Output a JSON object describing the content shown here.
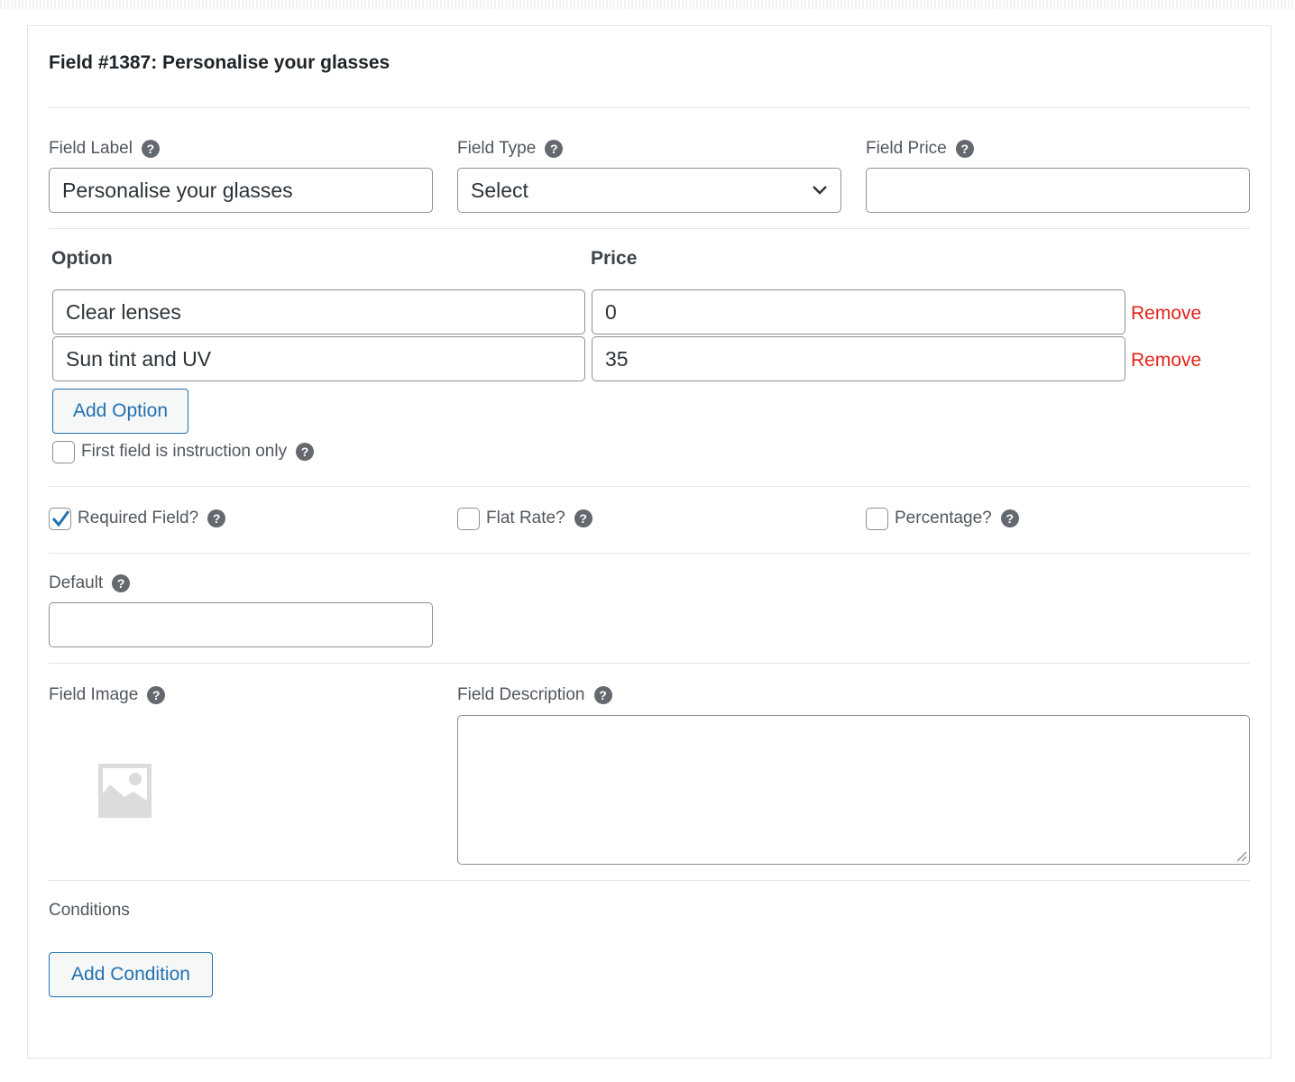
{
  "title": "Field #1387: Personalise your glasses",
  "field_label": {
    "label": "Field Label",
    "value": "Personalise your glasses"
  },
  "field_type": {
    "label": "Field Type",
    "value": "Select"
  },
  "field_price": {
    "label": "Field Price",
    "value": ""
  },
  "options": {
    "option_header": "Option",
    "price_header": "Price",
    "rows": [
      {
        "option": "Clear lenses",
        "price": "0",
        "remove": "Remove"
      },
      {
        "option": "Sun tint and UV",
        "price": "35",
        "remove": "Remove"
      }
    ],
    "add_label": "Add Option",
    "instruction_label": "First field is instruction only",
    "instruction_checked": false
  },
  "required": {
    "label": "Required Field?",
    "checked": true
  },
  "flat_rate": {
    "label": "Flat Rate?",
    "checked": false
  },
  "percentage": {
    "label": "Percentage?",
    "checked": false
  },
  "default": {
    "label": "Default",
    "value": ""
  },
  "field_image": {
    "label": "Field Image",
    "icon": "image-placeholder-icon"
  },
  "field_description": {
    "label": "Field Description",
    "value": ""
  },
  "conditions": {
    "label": "Conditions",
    "add_label": "Add Condition"
  },
  "colors": {
    "accent": "#2271b1",
    "remove": "#e2231a",
    "help": "#646970"
  }
}
